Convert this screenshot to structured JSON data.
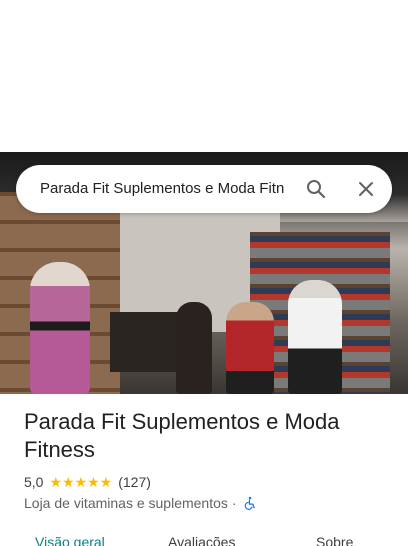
{
  "search": {
    "query": "Parada Fit Suplementos e Moda Fitn",
    "search_icon": "search-icon",
    "close_icon": "close-icon"
  },
  "place": {
    "name": "Parada Fit Suplementos e Moda Fitness",
    "rating": "5,0",
    "stars": "★★★★★",
    "review_count": "(127)",
    "category": "Loja de vitaminas e suplementos",
    "separator": "·",
    "accessibility_icon": "wheelchair-icon"
  },
  "tabs": [
    {
      "label": "Visão geral",
      "active": true
    },
    {
      "label": "Avaliações",
      "active": false
    },
    {
      "label": "Sobre",
      "active": false
    }
  ],
  "colors": {
    "accent": "#0b8085",
    "star": "#fbbc04",
    "accessibility": "#1a73e8"
  }
}
